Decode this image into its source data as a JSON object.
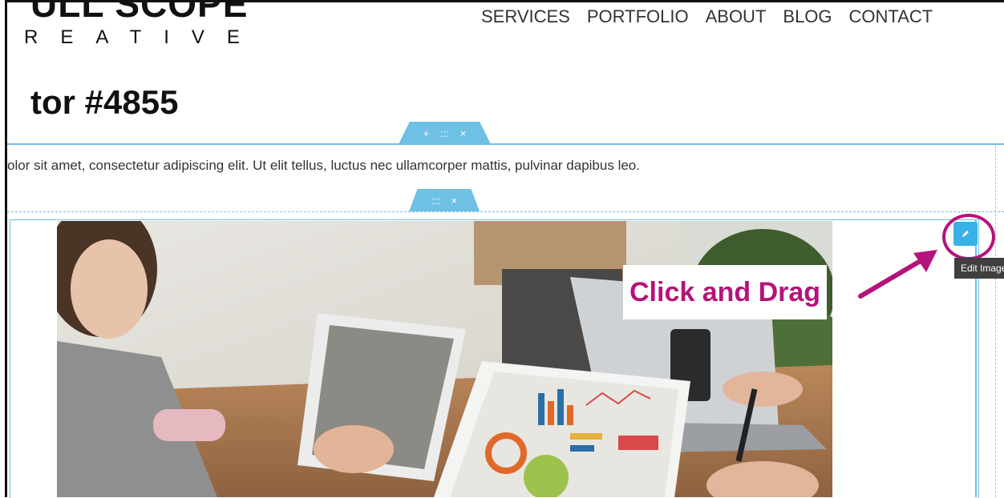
{
  "logo": {
    "top_text": "ULL SCOPE",
    "sub_text": "REATIVE"
  },
  "nav": {
    "items": [
      "SERVICES",
      "PORTFOLIO",
      "ABOUT",
      "BLOG",
      "CONTACT"
    ]
  },
  "page": {
    "title": "tor #4855",
    "paragraph": "olor sit amet, consectetur adipiscing elit. Ut elit tellus, luctus nec ullamcorper mattis, pulvinar dapibus leo."
  },
  "section_handle": {
    "add": "+",
    "drag": ":::",
    "close": "×"
  },
  "column_handle": {
    "drag": ":::",
    "close": "×"
  },
  "edit_button": {
    "icon": "pencil-icon",
    "tooltip": "Edit Image"
  },
  "annotation": {
    "text": "Click and Drag",
    "color": "#b5137b"
  },
  "colors": {
    "editor_accent": "#6ec1e4",
    "edit_button": "#39b0e6"
  }
}
